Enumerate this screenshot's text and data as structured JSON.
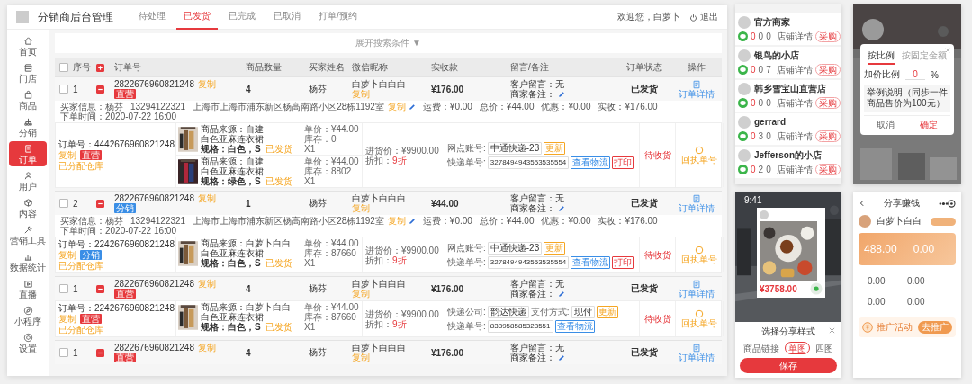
{
  "header": {
    "title": "分销商后台管理",
    "tabs": [
      {
        "label": "待处理",
        "selected": false
      },
      {
        "label": "已发货",
        "selected": true
      },
      {
        "label": "已完成",
        "selected": false
      },
      {
        "label": "已取消",
        "selected": false
      },
      {
        "label": "打单/预约",
        "selected": false
      }
    ],
    "welcome": "欢迎您，白萝卜",
    "logout": "退出"
  },
  "sidebar": [
    {
      "label": "首页",
      "selected": false
    },
    {
      "label": "门店",
      "selected": false
    },
    {
      "label": "商品",
      "selected": false
    },
    {
      "label": "分销",
      "selected": false
    },
    {
      "label": "订单",
      "selected": true
    },
    {
      "label": "用户",
      "selected": false
    },
    {
      "label": "内容",
      "selected": false
    },
    {
      "label": "营销工具",
      "selected": false
    },
    {
      "label": "数据统计",
      "selected": false
    },
    {
      "label": "直播",
      "selected": false
    },
    {
      "label": "小程序",
      "selected": false
    },
    {
      "label": "设置",
      "selected": false
    }
  ],
  "search_toggle": {
    "label": "展开搜索条件",
    "arrow": "▼"
  },
  "table": {
    "select_all_checked": false,
    "columns": [
      "序号",
      "订单号",
      "商品数量",
      "买家姓名",
      "微信昵称",
      "实收款",
      "留言/备注",
      "订单状态",
      "操作"
    ],
    "orders": [
      {
        "index": "1",
        "checked": false,
        "expanded": true,
        "order_no": "2822676960821248",
        "copy": "复制",
        "channel": {
          "label": "直营",
          "color": "#e6393d"
        },
        "quantity": "4",
        "buyer": "杨芬",
        "nickname": "白萝卜白白白",
        "nickname_copy": "复制",
        "amount": "¥176.00",
        "customer_note": "客户留言：无",
        "merchant_note": "商家备注：",
        "status": "已发货",
        "action": "订单详情",
        "info": {
          "buyer": "买家信息：杨芬",
          "phone": "13294122321",
          "address": "上海市上海市浦东新区杨高南路小区28栋1192室",
          "copy": "复制",
          "fees": [
            "运费：¥0.00",
            "总价：¥44.00",
            "优惠：¥0.00",
            "实收：¥176.00",
            "下单时间：2020-07-22 16:00"
          ]
        },
        "sub": {
          "order_no": "订单号：4442676960821248",
          "copy": "复制",
          "channel": {
            "label": "直营",
            "color": "#e6393d"
          },
          "note": "已分配仓库",
          "items": [
            {
              "source": "商品来源：自建",
              "name": "白色亚麻连衣裙",
              "spec": "规格：白色，S",
              "state": "已发货",
              "price": "单价：¥44.00",
              "stock": "库存：0",
              "qty": "X1"
            },
            {
              "source": "商品来源：自建",
              "name": "白色亚麻连衣裙",
              "spec": "规格：绿色，S",
              "state": "已发货",
              "price": "单价：¥44.00",
              "stock": "库存：8802",
              "qty": "X1"
            }
          ],
          "cost": "进货价：¥9900.00",
          "discount_label": "折扣：",
          "discount": "9折",
          "shipping": [
            [
              {
                "kind": "label",
                "text": "网点账号:"
              },
              {
                "kind": "field",
                "text": "中通快递-23"
              },
              {
                "kind": "button",
                "text": "更新",
                "color": "#f5a623"
              }
            ],
            [
              {
                "kind": "label",
                "text": "快递单号:"
              },
              {
                "kind": "number",
                "text": "3278494943553535554"
              },
              {
                "kind": "button",
                "text": "查看物流",
                "color": "#3a8ee6"
              },
              {
                "kind": "button",
                "text": "打印",
                "color": "#e6393d"
              }
            ]
          ],
          "status": "待收货",
          "action": "回执单号"
        }
      },
      {
        "index": "2",
        "checked": false,
        "expanded": true,
        "order_no": "2822676960821248",
        "copy": "复制",
        "channel": {
          "label": "分销",
          "color": "#3a8ee6"
        },
        "quantity": "1",
        "buyer": "杨芬",
        "nickname": "白萝卜白白白",
        "nickname_copy": "复制",
        "amount": "¥44.00",
        "customer_note": "客户留言：无",
        "merchant_note": "商家备注：",
        "status": "已发货",
        "action": "订单详情",
        "info": {
          "buyer": "买家信息：杨芬",
          "phone": "13294122321",
          "address": "上海市上海市浦东新区杨高南路小区28栋1192室",
          "copy": "复制",
          "fees": [
            "运费：¥0.00",
            "总价：¥44.00",
            "优惠：¥0.00",
            "实收：¥176.00",
            "下单时间：2020-07-22 16:00"
          ]
        },
        "sub": {
          "order_no": "订单号：2242676960821248",
          "copy": "复制",
          "channel": {
            "label": "分销",
            "color": "#3a8ee6"
          },
          "note": "已分配仓库",
          "items": [
            {
              "source": "商品来源：白萝卜白白",
              "name": "白色亚麻连衣裙",
              "spec": "规格：白色，S",
              "state": "已发货",
              "price": "单价：¥44.00",
              "stock": "库存：87660",
              "qty": "X1"
            }
          ],
          "cost": "进货价：¥9900.00",
          "discount_label": "折扣：",
          "discount": "9折",
          "shipping": [
            [
              {
                "kind": "label",
                "text": "网点账号:"
              },
              {
                "kind": "field",
                "text": "中通快递-23"
              },
              {
                "kind": "button",
                "text": "更新",
                "color": "#f5a623"
              }
            ],
            [
              {
                "kind": "label",
                "text": "快递单号:"
              },
              {
                "kind": "number",
                "text": "3278494943553535554"
              },
              {
                "kind": "button",
                "text": "查看物流",
                "color": "#3a8ee6"
              },
              {
                "kind": "button",
                "text": "打印",
                "color": "#e6393d"
              }
            ]
          ],
          "status": "待收货",
          "action": "回执单号"
        }
      },
      {
        "index": "1",
        "checked": false,
        "expanded": true,
        "order_no": "2822676960821248",
        "copy": "复制",
        "channel": {
          "label": "直营",
          "color": "#e6393d"
        },
        "quantity": "4",
        "buyer": "杨芬",
        "nickname": "白萝卜白白白",
        "nickname_copy": "复制",
        "amount": "¥176.00",
        "customer_note": "客户留言：无",
        "merchant_note": "商家备注：",
        "status": "已发货",
        "action": "订单详情",
        "sub": {
          "order_no": "订单号：2242676960821248",
          "copy": "复制",
          "channel": {
            "label": "直营",
            "color": "#e6393d"
          },
          "note": "已分配仓库",
          "items": [
            {
              "source": "商品来源：白萝卜白白",
              "name": "白色亚麻连衣裙",
              "spec": "规格：白色，S",
              "state": "已发货",
              "price": "单价：¥44.00",
              "stock": "库存：87660",
              "qty": "X1"
            }
          ],
          "cost": "进货价：¥9900.00",
          "discount_label": "折扣：",
          "discount": "9折",
          "shipping": [
            [
              {
                "kind": "label",
                "text": "快递公司:"
              },
              {
                "kind": "field",
                "text": "韵达快递"
              },
              {
                "kind": "label",
                "text": "支付方式:"
              },
              {
                "kind": "field",
                "text": "现付"
              },
              {
                "kind": "button",
                "text": "更新",
                "color": "#f5a623"
              }
            ],
            [
              {
                "kind": "label",
                "text": "快递单号:"
              },
              {
                "kind": "number",
                "text": "838958585328551"
              },
              {
                "kind": "button",
                "text": "查看物流",
                "color": "#3a8ee6"
              }
            ]
          ],
          "status": "待收货",
          "action": "回执单号"
        }
      },
      {
        "index": "1",
        "checked": false,
        "expanded": true,
        "order_no": "2822676960821248",
        "copy": "复制",
        "channel": {
          "label": "直营",
          "color": "#e6393d"
        },
        "quantity": "4",
        "buyer": "杨芬",
        "nickname": "白萝卜白白白",
        "nickname_copy": "复制",
        "amount": "¥176.00",
        "customer_note": "客户留言：无",
        "merchant_note": "商家备注：",
        "status": "已发货",
        "action": "订单详情"
      }
    ]
  },
  "shops": [
    {
      "name": "官方商家",
      "stats": [
        "0",
        "0",
        "0"
      ],
      "detail": "店铺详情",
      "button": "采购"
    },
    {
      "name": "银鸟的小店",
      "stats": [
        "0",
        "0",
        "7"
      ],
      "detail": "店铺详情",
      "button": "采购"
    },
    {
      "name": "韩乡雪宝山直营店",
      "stats": [
        "0",
        "0",
        "0"
      ],
      "detail": "店铺详情",
      "button": "采购"
    },
    {
      "name": "gerrard",
      "stats": [
        "0",
        "3",
        "0"
      ],
      "detail": "店铺详情",
      "button": "采购"
    },
    {
      "name": "Jefferson的小店",
      "stats": [
        "0",
        "2",
        "0"
      ],
      "detail": "店铺详情",
      "button": "采购"
    }
  ],
  "ratio_dialog": {
    "tabs": [
      {
        "label": "按比例",
        "selected": true
      },
      {
        "label": "按固定金额",
        "selected": false
      }
    ],
    "field_label": "加价比例",
    "value": "0",
    "unit": "%",
    "example_title": "举例说明（同步一件商品售价为100元）",
    "cancel": "取消",
    "confirm": "确定"
  },
  "share_sheet": {
    "time": "9:41",
    "price": "¥3758.00",
    "title": "选择分享样式",
    "options": [
      {
        "label": "商品链接",
        "selected": false
      },
      {
        "label": "单图",
        "selected": true
      },
      {
        "label": "四图",
        "selected": false
      }
    ],
    "save": "保存"
  },
  "earn_page": {
    "title": "分享赚钱",
    "user": "白萝卜白白",
    "balance": "488.00",
    "balance2": "0.00",
    "stats": [
      "0.00",
      "0.00",
      "0.00",
      "0.00"
    ],
    "promo": "推广活动",
    "promo_button": "去推广"
  }
}
